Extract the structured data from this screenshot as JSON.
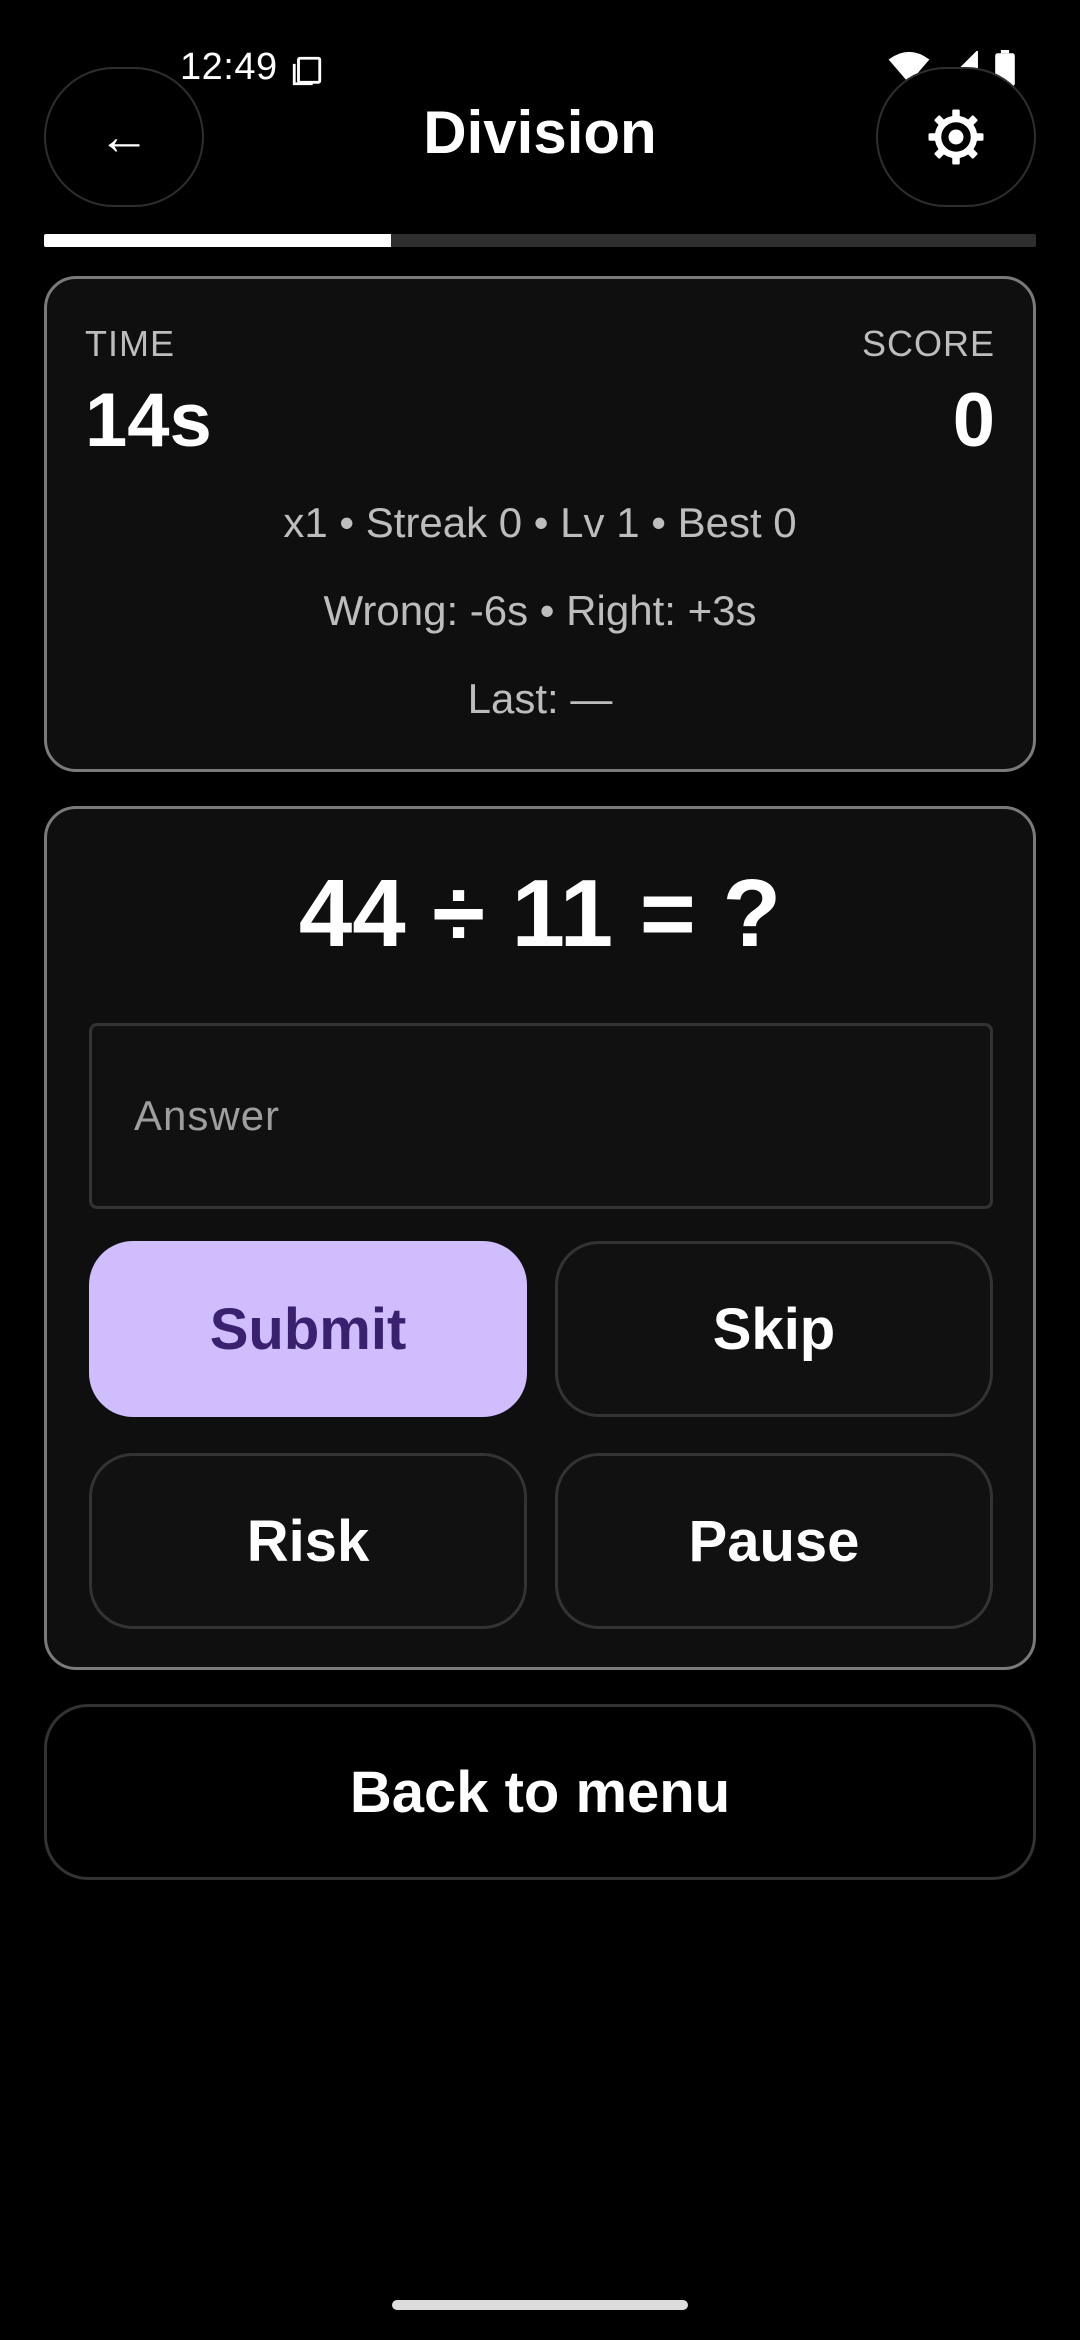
{
  "status_bar": {
    "time": "12:49",
    "icons": [
      "copy-icon",
      "wifi-icon",
      "signal-icon",
      "battery-icon"
    ]
  },
  "header": {
    "title": "Division",
    "back_label": "←",
    "settings_icon": "gear-icon"
  },
  "progress": {
    "value_fraction": 0.35
  },
  "stats": {
    "time_label": "TIME",
    "time_value": "14s",
    "score_label": "SCORE",
    "score_value": "0",
    "line1": "x1 • Streak 0 • Lv 1 • Best 0",
    "line2": "Wrong: -6s • Right: +3s",
    "line3": "Last: —"
  },
  "question": {
    "text": "44 ÷ 11 = ?",
    "answer_placeholder": "Answer",
    "answer_value": ""
  },
  "buttons": {
    "submit": "Submit",
    "skip": "Skip",
    "risk": "Risk",
    "pause": "Pause",
    "back_to_menu": "Back to menu"
  },
  "colors": {
    "background": "#000000",
    "accent": "#cfbdfe",
    "accent_text": "#3a2170",
    "card_border": "#7a7a7a"
  }
}
